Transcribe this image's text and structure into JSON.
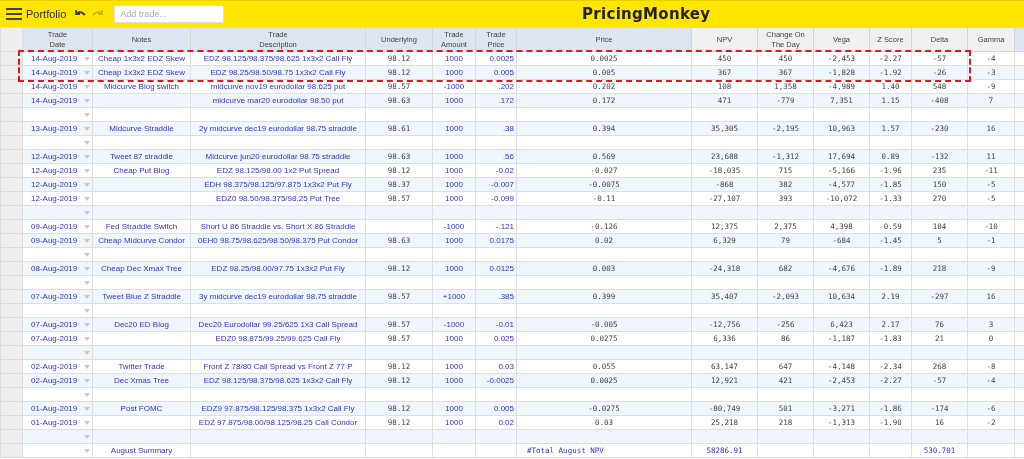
{
  "toolbar": {
    "title": "Portfolio",
    "undo_disabled": false,
    "redo_disabled": true,
    "search": {
      "placeholder": "Add trade..."
    },
    "brand": "PricingMonkey"
  },
  "columns": [
    {
      "label": "Trade\nDate"
    },
    {
      "label": "Notes"
    },
    {
      "label": "Trade\nDescription"
    },
    {
      "label": "Underlying"
    },
    {
      "label": "Trade\nAmount"
    },
    {
      "label": "Trade\nPrice"
    },
    {
      "label": "Price"
    },
    {
      "label": "NPV"
    },
    {
      "label": "Change On\nThe Day"
    },
    {
      "label": "Vega"
    },
    {
      "label": "Z Score"
    },
    {
      "label": "Delta"
    },
    {
      "label": "Gamma"
    }
  ],
  "rows": [
    {
      "kind": "trade",
      "highlighted": true,
      "date": "14-Aug-2019",
      "notes": "Cheap 1x3x2 EDZ Skew",
      "description": "EDZ 98.125/98.375/98.625 1x3x2 Call Fly",
      "underlying": "98.12",
      "amount": "1000",
      "trade_price": "0.0025",
      "price": "0.0025",
      "npv": "450",
      "change": "450",
      "vega": "-2,453",
      "z_score": "-2.27",
      "delta": "-57",
      "gamma": "-4"
    },
    {
      "kind": "trade",
      "highlighted": true,
      "date": "14-Aug-2019",
      "notes": "Cheap 1x3x2 EDZ Skew",
      "description": "EDZ 98.25/98.50/98.75 1x3x2 Call Fly",
      "underlying": "98.12",
      "amount": "1000",
      "trade_price": "0.005",
      "price": "0.005",
      "npv": "367",
      "change": "367",
      "vega": "-1,828",
      "z_score": "-1.92",
      "delta": "-26",
      "gamma": "-3"
    },
    {
      "kind": "trade",
      "highlighted": false,
      "date": "14-Aug-2019",
      "notes": "Midcurve Blog switch",
      "description": "midcurve nov19 eurodollar 98.625 put",
      "underlying": "98.57",
      "amount": "-1000",
      "trade_price": ".202",
      "price": "0.202",
      "npv": "108",
      "change": "1,358",
      "vega": "-4,989",
      "z_score": "1.40",
      "delta": "548",
      "gamma": "-9"
    },
    {
      "kind": "trade",
      "highlighted": false,
      "date": "14-Aug-2019",
      "description": "midcurve mar20 eurodollar 98.50 put",
      "underlying": "98.63",
      "amount": "1000",
      "trade_price": ".172",
      "price": "0.172",
      "npv": "471",
      "change": "-779",
      "vega": "7,351",
      "z_score": "1.15",
      "delta": "-408",
      "gamma": "7"
    },
    {
      "kind": "blank",
      "highlighted": false
    },
    {
      "kind": "trade",
      "highlighted": false,
      "date": "13-Aug-2019",
      "notes": "Midcurve Straddle",
      "description": "2y midcurve dec19 eurodollar 98.75 straddle",
      "underlying": "98.61",
      "amount": "1000",
      "trade_price": ".38",
      "price": "0.394",
      "npv": "35,305",
      "change": "-2,195",
      "vega": "10,963",
      "z_score": "1.57",
      "delta": "-230",
      "gamma": "16"
    },
    {
      "kind": "blank",
      "highlighted": false
    },
    {
      "kind": "trade",
      "highlighted": false,
      "date": "12-Aug-2019",
      "notes": "Tweet 87 straddle",
      "description": "Midcurve jun20 eurodollar 98.75 straddle",
      "underlying": "98.63",
      "amount": "1000",
      "trade_price": ".56",
      "price": "0.569",
      "npv": "23,688",
      "change": "-1,312",
      "vega": "17,694",
      "z_score": "0.89",
      "delta": "-132",
      "gamma": "11"
    },
    {
      "kind": "trade",
      "highlighted": false,
      "date": "12-Aug-2019",
      "notes": "Cheap Put Blog",
      "description": "EDZ 98.125/98.00 1x2 Put Spread",
      "underlying": "98.12",
      "amount": "1000",
      "trade_price": "-0.02",
      "price": "-0.027",
      "npv": "-18,035",
      "change": "715",
      "vega": "-5,166",
      "z_score": "-1.96",
      "delta": "235",
      "gamma": "-11"
    },
    {
      "kind": "trade",
      "highlighted": false,
      "date": "12-Aug-2019",
      "description": "EDH 98.375/98.125/97.875 1x3x2 Put Fly",
      "underlying": "98.37",
      "amount": "1000",
      "trade_price": "-0.007",
      "price": "-0.0075",
      "npv": "-868",
      "change": "382",
      "vega": "-4,577",
      "z_score": "-1.85",
      "delta": "150",
      "gamma": "-5"
    },
    {
      "kind": "trade",
      "highlighted": false,
      "date": "12-Aug-2019",
      "description": "EDZ0 98.50/98.375/98.25 Put Tree",
      "underlying": "98.57",
      "amount": "1000",
      "trade_price": "-0.099",
      "price": "-0.11",
      "npv": "-27,107",
      "change": "393",
      "vega": "-10,072",
      "z_score": "-1.33",
      "delta": "270",
      "gamma": "-5"
    },
    {
      "kind": "blank",
      "highlighted": false
    },
    {
      "kind": "trade",
      "highlighted": false,
      "date": "09-Aug-2019",
      "notes": "Fed Straddle Switch",
      "description": "Short U 86 Straddle vs. Short X 86 Straddle",
      "amount": "-1000",
      "trade_price": "-.121",
      "price": "-0.126",
      "npv": "12,375",
      "change": "2,375",
      "vega": "4,398",
      "z_score": "-0.59",
      "delta": "104",
      "gamma": "-10"
    },
    {
      "kind": "trade",
      "highlighted": false,
      "date": "09-Aug-2019",
      "notes": "Cheap Midcurve Condor",
      "description": "0EH0 98.75/98.625/98.50/98.375 Put Condor",
      "underlying": "98.63",
      "amount": "1000",
      "trade_price": "0.0175",
      "price": "0.02",
      "npv": "6,329",
      "change": "79",
      "vega": "-684",
      "z_score": "-1.45",
      "delta": "5",
      "gamma": "-1"
    },
    {
      "kind": "blank",
      "highlighted": false
    },
    {
      "kind": "trade",
      "highlighted": false,
      "date": "08-Aug-2019",
      "notes": "Cheap Dec Xmax Tree",
      "description": "EDZ 98.25/98.00/97.75 1x3x2 Put Fly",
      "underlying": "98.12",
      "amount": "1000",
      "trade_price": "0.0125",
      "price": "0.003",
      "npv": "-24,318",
      "change": "682",
      "vega": "-4,676",
      "z_score": "-1.89",
      "delta": "218",
      "gamma": "-9"
    },
    {
      "kind": "blank",
      "highlighted": false
    },
    {
      "kind": "trade",
      "highlighted": false,
      "date": "07-Aug-2019",
      "notes": "Tweet Blue Z Straddle",
      "description": "3y midcurve dec19 eurodollar 98.75 straddle",
      "underlying": "98.57",
      "amount": "+1000",
      "trade_price": ".385",
      "price": "0.399",
      "npv": "35,407",
      "change": "-2,093",
      "vega": "10,634",
      "z_score": "2.19",
      "delta": "-297",
      "gamma": "16"
    },
    {
      "kind": "blank",
      "highlighted": false
    },
    {
      "kind": "trade",
      "highlighted": false,
      "date": "07-Aug-2019",
      "notes": "Dec20 ED Blog",
      "description": "Dec20 Eurodollar 99.25/625 1x3 Call Spread",
      "underlying": "98.57",
      "amount": "-1000",
      "trade_price": "-0.01",
      "price": "-0.005",
      "npv": "-12,756",
      "change": "-256",
      "vega": "6,423",
      "z_score": "2.17",
      "delta": "76",
      "gamma": "3"
    },
    {
      "kind": "trade",
      "highlighted": false,
      "date": "07-Aug-2019",
      "description": "EDZ0 98.875/99.25/99.625 Call Fly",
      "underlying": "98.57",
      "amount": "1000",
      "trade_price": "0.025",
      "price": "0.0275",
      "npv": "6,336",
      "change": "86",
      "vega": "-1,187",
      "z_score": "-1.83",
      "delta": "21",
      "gamma": "0"
    },
    {
      "kind": "blank",
      "highlighted": false
    },
    {
      "kind": "trade",
      "highlighted": false,
      "date": "02-Aug-2019",
      "notes": "Twitter Trade",
      "description": "Front Z 78/80 Call Spread vs Front Z 77 P",
      "underlying": "98.12",
      "amount": "1000",
      "trade_price": "0.03",
      "price": "0.055",
      "npv": "63,147",
      "change": "647",
      "vega": "-4,148",
      "z_score": "-2.34",
      "delta": "268",
      "gamma": "-8"
    },
    {
      "kind": "trade",
      "highlighted": false,
      "date": "02-Aug-2019",
      "notes": "Dec Xmas Tree",
      "description": "EDZ 98.125/98.375/98.625 1x3x2 Call Fly",
      "underlying": "98.12",
      "amount": "1000",
      "trade_price": "-0.0025",
      "price": "0.0025",
      "npv": "12,921",
      "change": "421",
      "vega": "-2,453",
      "z_score": "-2.27",
      "delta": "-57",
      "gamma": "-4"
    },
    {
      "kind": "blank",
      "highlighted": false
    },
    {
      "kind": "trade",
      "highlighted": false,
      "date": "01-Aug-2019",
      "notes": "Post FOMC",
      "description": "EDZ9 97.875/98.125/98.375 1x3x2 Call Fly",
      "underlying": "98.12",
      "amount": "1000",
      "trade_price": "0.005",
      "price": "-0.0275",
      "npv": "-80,749",
      "change": "501",
      "vega": "-3,271",
      "z_score": "-1.86",
      "delta": "-174",
      "gamma": "-6"
    },
    {
      "kind": "trade",
      "highlighted": false,
      "date": "01-Aug-2019",
      "description": "EDZ 97.875/98.00/98.125/98.25 Call Condor",
      "underlying": "98.12",
      "amount": "1000",
      "trade_price": "0.02",
      "price": "0.03",
      "npv": "25,218",
      "change": "218",
      "vega": "-1,313",
      "z_score": "-1.90",
      "delta": "16",
      "gamma": "-2"
    },
    {
      "kind": "blank",
      "highlighted": false
    },
    {
      "kind": "summary",
      "highlighted": false,
      "notes": "August Summary",
      "price": "#Total August NPV",
      "npv": "58286.91",
      "delta": "530.701"
    }
  ]
}
